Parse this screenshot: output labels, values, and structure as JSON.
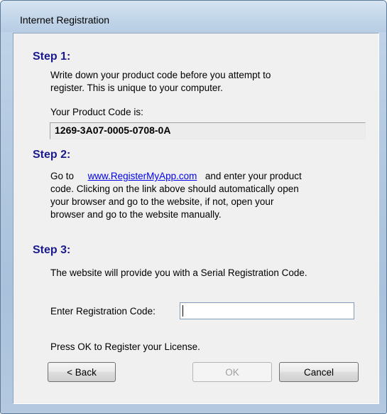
{
  "window": {
    "title": "Internet Registration"
  },
  "step1": {
    "heading": "Step 1:",
    "line1": "Write down your product code before you attempt to",
    "line2": "register.  This is unique to your computer.",
    "code_label": "Your Product Code is:",
    "code_value": "1269-3A07-0005-0708-0A"
  },
  "step2": {
    "heading": "Step 2:",
    "line1_prefix": "Go to",
    "link_text": "www.RegisterMyApp.com",
    "line1_suffix": "and enter your product",
    "line2": "code.  Clicking on the link above should automatically open",
    "line3": "your browser and go to the website, if not, open your",
    "line4": "browser and go to the website manually."
  },
  "step3": {
    "heading": "Step 3:",
    "line1": "The website will provide you with a Serial Registration Code.",
    "reg_label": "Enter Registration Code:",
    "reg_value": "",
    "ok_hint": "Press OK to Register your License."
  },
  "buttons": {
    "back": "< Back",
    "ok": "OK",
    "cancel": "Cancel"
  },
  "colors": {
    "step_heading": "#1a1a8c",
    "link": "#0000ee"
  }
}
